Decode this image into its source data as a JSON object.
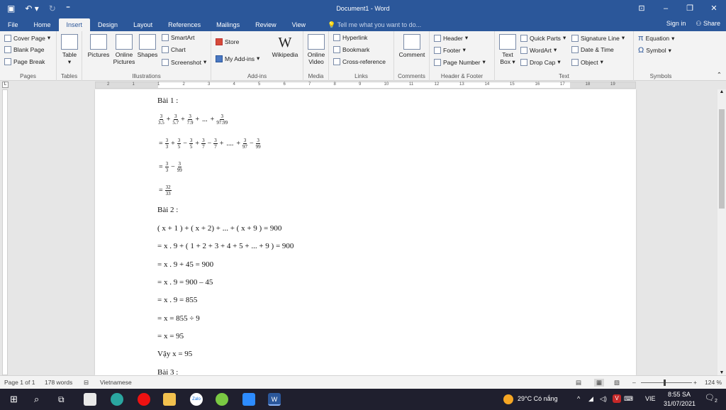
{
  "window": {
    "title": "Document1 - Word",
    "tabs": [
      "File",
      "Home",
      "Insert",
      "Design",
      "Layout",
      "References",
      "Mailings",
      "Review",
      "View"
    ],
    "active_tab": "Insert",
    "tell_me": "Tell me what you want to do...",
    "sign_in": "Sign in",
    "share": "Share"
  },
  "ribbon": {
    "pages": {
      "label": "Pages",
      "cover": "Cover Page",
      "blank": "Blank Page",
      "break": "Page Break"
    },
    "tables": {
      "label": "Tables",
      "table": "Table"
    },
    "illustrations": {
      "label": "Illustrations",
      "pictures": "Pictures",
      "online_pictures_1": "Online",
      "online_pictures_2": "Pictures",
      "shapes": "Shapes",
      "smartart": "SmartArt",
      "chart": "Chart",
      "screenshot": "Screenshot"
    },
    "addins": {
      "label": "Add-ins",
      "store": "Store",
      "my_addins": "My Add-ins",
      "wikipedia": "Wikipedia"
    },
    "media": {
      "label": "Media",
      "online_video_1": "Online",
      "online_video_2": "Video"
    },
    "links": {
      "label": "Links",
      "hyperlink": "Hyperlink",
      "bookmark": "Bookmark",
      "cross_reference": "Cross-reference"
    },
    "comments": {
      "label": "Comments",
      "comment": "Comment"
    },
    "header_footer": {
      "label": "Header & Footer",
      "header": "Header",
      "footer": "Footer",
      "page_number": "Page Number"
    },
    "text": {
      "label": "Text",
      "text_box_1": "Text",
      "text_box_2": "Box",
      "quick_parts": "Quick Parts",
      "wordart": "WordArt",
      "drop_cap": "Drop Cap",
      "signature_line": "Signature Line",
      "date_time": "Date & Time",
      "object": "Object"
    },
    "symbols": {
      "label": "Symbols",
      "equation": "Equation",
      "symbol": "Symbol"
    }
  },
  "ruler_ticks": [
    "2",
    "1",
    "1",
    "2",
    "3",
    "4",
    "5",
    "6",
    "7",
    "8",
    "9",
    "10",
    "11",
    "12",
    "13",
    "14",
    "15",
    "16",
    "17",
    "18",
    "19"
  ],
  "document": {
    "bai1": "Bài 1 :",
    "bai1_line1": {
      "fracs": [
        [
          "3",
          "3.5"
        ],
        [
          "3",
          "5.7"
        ],
        [
          "3",
          "7.9"
        ],
        [
          "3",
          "97.99"
        ]
      ],
      "ellipsis": "..."
    },
    "bai1_line2": {
      "fracs": [
        [
          "3",
          "3"
        ],
        [
          "3",
          "5"
        ],
        [
          "3",
          "5"
        ],
        [
          "3",
          "7"
        ],
        [
          "3",
          "7"
        ],
        [
          "3",
          "97"
        ],
        [
          "3",
          "99"
        ]
      ],
      "ellipsis": "...."
    },
    "bai1_line3": {
      "fracs": [
        [
          "3",
          "3"
        ],
        [
          "3",
          "99"
        ]
      ]
    },
    "bai1_line4": {
      "fracs": [
        [
          "32",
          "33"
        ]
      ]
    },
    "bai2": "Bài 2 :",
    "bai2_lines": [
      "( x + 1 ) + ( x + 2) + ... + ( x + 9 ) = 900",
      "=  x . 9 + ( 1 + 2 + 3 + 4 + 5 + ... + 9 ) = 900",
      "=  x . 9 + 45 = 900",
      "=  x . 9 = 900 – 45",
      "=  x . 9 = 855",
      "=  x = 855 ÷ 9",
      "=  x = 95",
      "Vậy x = 95"
    ],
    "bai3": "Bài 3 :"
  },
  "status": {
    "page": "Page 1 of 1",
    "words": "178 words",
    "language": "Vietnamese",
    "zoom": "124 %"
  },
  "taskbar": {
    "weather": "29°C  Có nắng",
    "lang": "VIE",
    "time": "8:55 SA",
    "date": "31/07/2021",
    "notif": "2"
  }
}
